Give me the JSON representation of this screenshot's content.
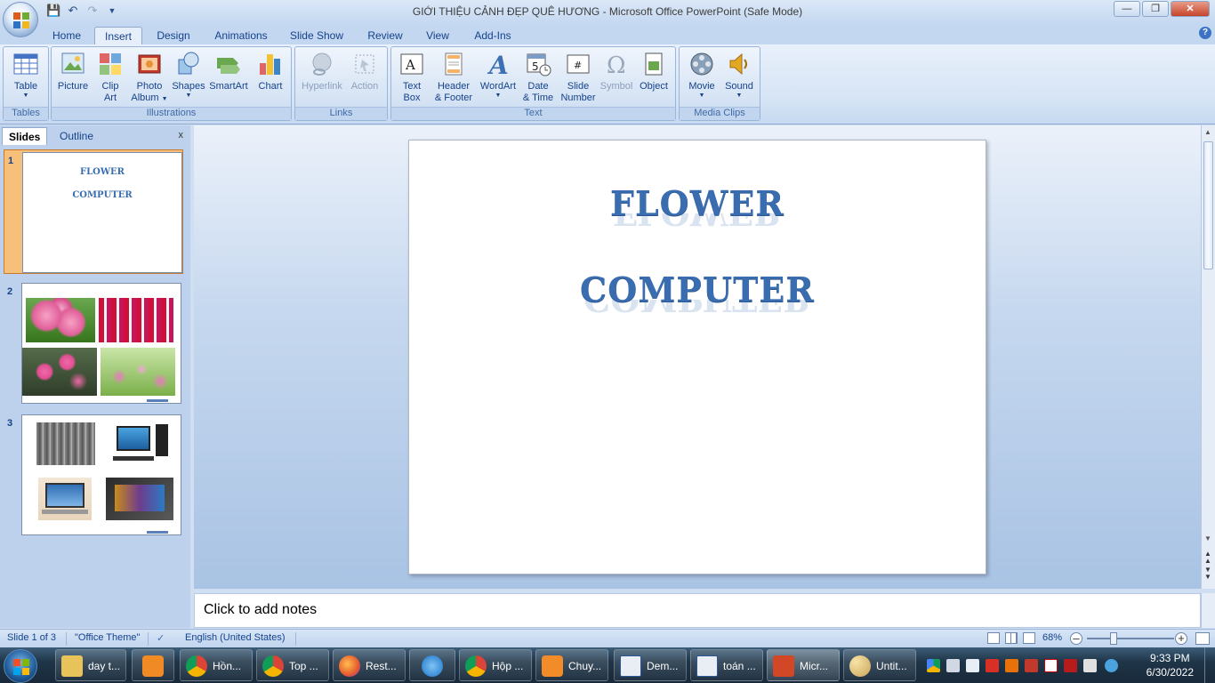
{
  "window": {
    "title": "GIỚI THIỆU CẢNH ĐẸP QUÊ HƯƠNG - Microsoft Office PowerPoint (Safe Mode)"
  },
  "tabs": [
    "Home",
    "Insert",
    "Design",
    "Animations",
    "Slide Show",
    "Review",
    "View",
    "Add-Ins"
  ],
  "active_tab": "Insert",
  "ribbon": {
    "groups": [
      {
        "label": "Tables",
        "buttons": [
          {
            "l1": "Table",
            "l2": "",
            "icon": "table-icon"
          }
        ]
      },
      {
        "label": "Illustrations",
        "buttons": [
          {
            "l1": "Picture",
            "l2": "",
            "icon": "picture-icon"
          },
          {
            "l1": "Clip",
            "l2": "Art",
            "icon": "clip-art-icon"
          },
          {
            "l1": "Photo",
            "l2": "Album",
            "icon": "photo-album-icon"
          },
          {
            "l1": "Shapes",
            "l2": "",
            "icon": "shapes-icon"
          },
          {
            "l1": "SmartArt",
            "l2": "",
            "icon": "smartart-icon"
          },
          {
            "l1": "Chart",
            "l2": "",
            "icon": "chart-icon"
          }
        ]
      },
      {
        "label": "Links",
        "buttons": [
          {
            "l1": "Hyperlink",
            "l2": "",
            "icon": "hyperlink-icon"
          },
          {
            "l1": "Action",
            "l2": "",
            "icon": "action-icon"
          }
        ]
      },
      {
        "label": "Text",
        "buttons": [
          {
            "l1": "Text",
            "l2": "Box",
            "icon": "text-box-icon"
          },
          {
            "l1": "Header",
            "l2": "& Footer",
            "icon": "header-footer-icon"
          },
          {
            "l1": "WordArt",
            "l2": "",
            "icon": "wordart-icon"
          },
          {
            "l1": "Date",
            "l2": "& Time",
            "icon": "date-time-icon"
          },
          {
            "l1": "Slide",
            "l2": "Number",
            "icon": "slide-number-icon"
          },
          {
            "l1": "Symbol",
            "l2": "",
            "icon": "symbol-icon"
          },
          {
            "l1": "Object",
            "l2": "",
            "icon": "object-icon"
          }
        ]
      },
      {
        "label": "Media Clips",
        "buttons": [
          {
            "l1": "Movie",
            "l2": "",
            "icon": "movie-icon"
          },
          {
            "l1": "Sound",
            "l2": "",
            "icon": "sound-icon"
          }
        ]
      }
    ]
  },
  "pane": {
    "tab_slides": "Slides",
    "tab_outline": "Outline",
    "close": "x"
  },
  "thumbnails": [
    {
      "num": "1",
      "line1": "FLOWER",
      "line2": "COMPUTER"
    },
    {
      "num": "2"
    },
    {
      "num": "3"
    }
  ],
  "slide": {
    "line1": "FLOWER",
    "line2": "COMPUTER"
  },
  "notes": {
    "placeholder": "Click to add notes"
  },
  "status": {
    "slide_info": "Slide 1 of 3",
    "theme": "\"Office Theme\"",
    "language": "English (United States)",
    "zoom": "68%"
  },
  "taskbar": {
    "items": [
      "day t...",
      "",
      "Hồn...",
      "Top ...",
      "Rest...",
      "",
      "Hộp ...",
      "Chuy...",
      "Dem...",
      "toán ...",
      "Micr...",
      "Untit..."
    ],
    "time": "9:33 PM",
    "date": "6/30/2022"
  }
}
